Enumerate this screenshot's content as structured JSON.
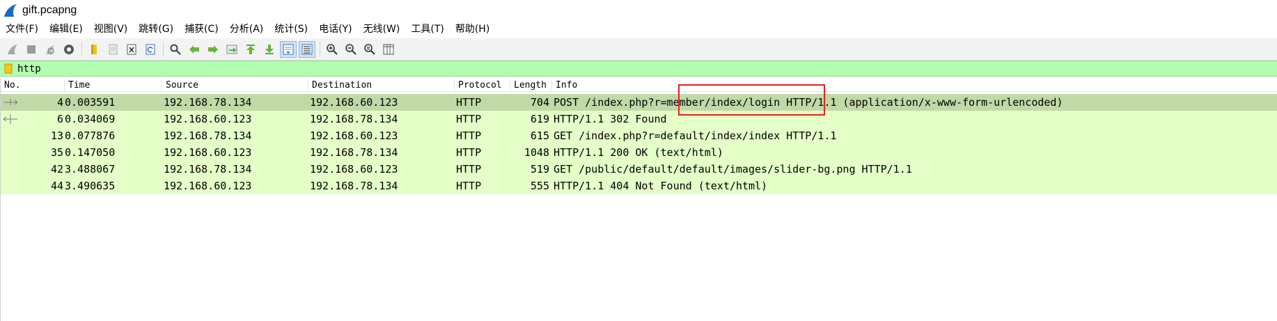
{
  "window": {
    "title": "gift.pcapng"
  },
  "menubar": {
    "items": [
      "文件(F)",
      "编辑(E)",
      "视图(V)",
      "跳转(G)",
      "捕获(C)",
      "分析(A)",
      "统计(S)",
      "电话(Y)",
      "无线(W)",
      "工具(T)",
      "帮助(H)"
    ]
  },
  "toolbar": {
    "icons": [
      "start-capture-icon",
      "stop-capture-icon",
      "restart-capture-icon",
      "capture-options-icon",
      "open-file-icon",
      "save-file-icon",
      "close-file-icon",
      "reload-file-icon",
      "find-packet-icon",
      "go-back-icon",
      "go-forward-icon",
      "go-to-packet-icon",
      "go-first-icon",
      "go-last-icon",
      "auto-scroll-icon",
      "colorize-icon",
      "zoom-in-icon",
      "zoom-out-icon",
      "zoom-normal-icon",
      "resize-columns-icon"
    ]
  },
  "filter": {
    "value": "http"
  },
  "packet_list": {
    "columns": [
      "No.",
      "Time",
      "Source",
      "Destination",
      "Protocol",
      "Length",
      "Info"
    ],
    "rows": [
      {
        "no": "4",
        "time": "0.003591",
        "source": "192.168.78.134",
        "destination": "192.168.60.123",
        "protocol": "HTTP",
        "length": "704",
        "info": "POST /index.php?r=member/index/login HTTP/1.1  (application/x-www-form-urlencoded)",
        "selected": true
      },
      {
        "no": "6",
        "time": "0.034069",
        "source": "192.168.60.123",
        "destination": "192.168.78.134",
        "protocol": "HTTP",
        "length": "619",
        "info": "HTTP/1.1 302 Found",
        "selected": false
      },
      {
        "no": "13",
        "time": "0.077876",
        "source": "192.168.78.134",
        "destination": "192.168.60.123",
        "protocol": "HTTP",
        "length": "615",
        "info": "GET /index.php?r=default/index/index HTTP/1.1",
        "selected": false
      },
      {
        "no": "35",
        "time": "0.147050",
        "source": "192.168.60.123",
        "destination": "192.168.78.134",
        "protocol": "HTTP",
        "length": "1048",
        "info": "HTTP/1.1 200 OK  (text/html)",
        "selected": false
      },
      {
        "no": "42",
        "time": "3.488067",
        "source": "192.168.78.134",
        "destination": "192.168.60.123",
        "protocol": "HTTP",
        "length": "519",
        "info": "GET /public/default/default/images/slider-bg.png HTTP/1.1",
        "selected": false
      },
      {
        "no": "44",
        "time": "3.490635",
        "source": "192.168.60.123",
        "destination": "192.168.78.134",
        "protocol": "HTTP",
        "length": "555",
        "info": "HTTP/1.1 404 Not Found  (text/html)",
        "selected": false
      }
    ]
  },
  "colors": {
    "filter_valid_bg": "#afffaf",
    "http_row_bg": "#e4ffc7",
    "selected_row_bg": "#c0d9a7",
    "highlight_box": "#e8201a"
  }
}
